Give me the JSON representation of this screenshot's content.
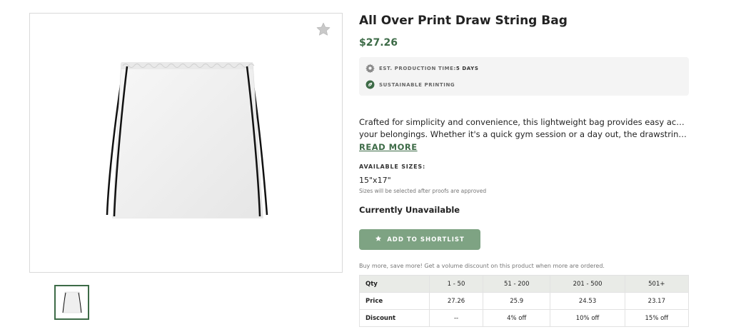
{
  "product": {
    "title": "All Over Print Draw String Bag",
    "price": "$27.26",
    "colors": {
      "accent": "#3d6b47",
      "button": "#7ea383"
    }
  },
  "features": {
    "production_label": "EST. PRODUCTION TIME: ",
    "production_value": "5 DAYS",
    "production_icon": "gear-icon",
    "sustainable_label": "SUSTAINABLE PRINTING",
    "sustainable_icon": "leaf-icon"
  },
  "description": {
    "line1": "Crafted for simplicity and convenience, this lightweight bag provides easy access to",
    "line2": "your belongings. Whether it's a quick gym session or a day out, the drawstring bag i…",
    "read_more": "READ MORE"
  },
  "sizes": {
    "heading": "AVAILABLE SIZES:",
    "value": "15\"x17\"",
    "note": "Sizes will be selected after proofs are approved"
  },
  "availability": "Currently Unavailable",
  "shortlist_button": "ADD TO SHORTLIST",
  "volume_note": "Buy more, save more! Get a volume discount on this product when more are ordered.",
  "pricing_table": {
    "headers": [
      "Qty",
      "1 - 50",
      "51 - 200",
      "201 - 500",
      "501+"
    ],
    "price_row": [
      "Price",
      "27.26",
      "25.9",
      "24.53",
      "23.17"
    ],
    "discount_row": [
      "Discount",
      "--",
      "4% off",
      "10% off",
      "15% off"
    ]
  }
}
